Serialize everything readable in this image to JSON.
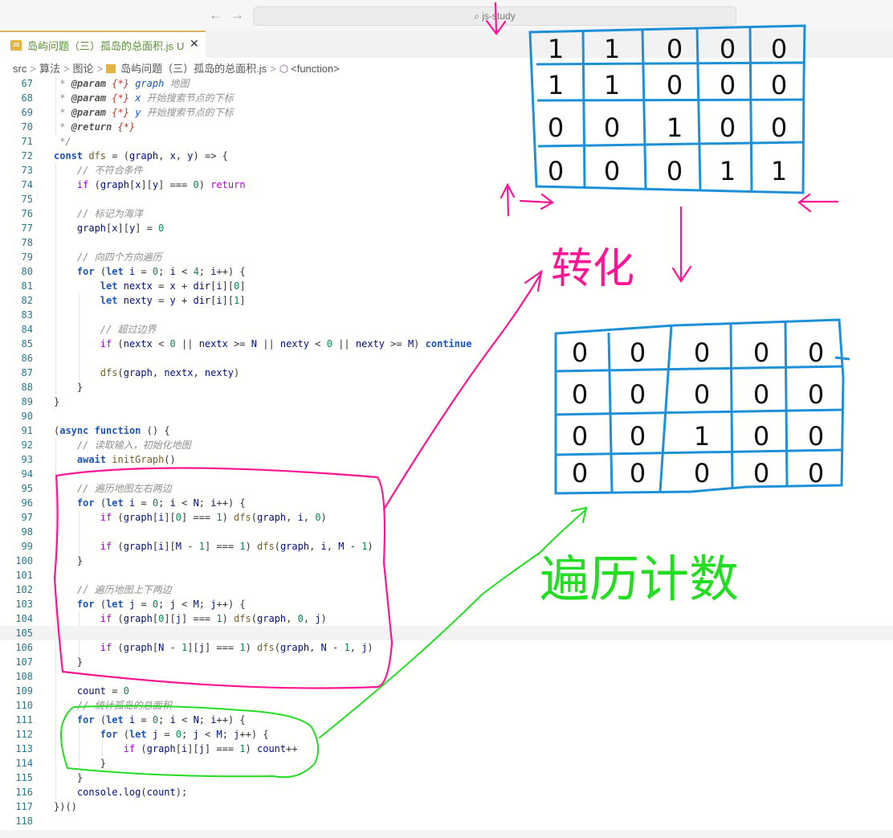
{
  "window": {
    "search_text": "js-study",
    "back_arrow": "←",
    "forward_arrow": "→"
  },
  "tab": {
    "badge": "JS",
    "title": "岛屿问题（三）孤岛的总面积.js",
    "status": "U",
    "close": "✕"
  },
  "breadcrumb": {
    "items": [
      "src",
      "算法",
      "图论",
      "岛屿问题（三）孤岛的总面积.js",
      "<function>"
    ],
    "separator": ">"
  },
  "colors": {
    "code_bg": "#fffffe",
    "line_number": "#237893",
    "keyword": "#0000ff",
    "comment": "#8e8e8e",
    "annotation_pink": "#ff1493",
    "annotation_green": "#22dd22",
    "grid_blue": "#1e90d8"
  },
  "code_lines": [
    {
      "num": "67",
      "text": " * @param {*} graph 地图"
    },
    {
      "num": "68",
      "text": " * @param {*} x 开始搜索节点的下标"
    },
    {
      "num": "69",
      "text": " * @param {*} y 开始搜索节点的下标"
    },
    {
      "num": "70",
      "text": " * @return {*}"
    },
    {
      "num": "71",
      "text": " */"
    },
    {
      "num": "72",
      "text": "const dfs = (graph, x, y) => {"
    },
    {
      "num": "73",
      "text": "    // 不符合条件"
    },
    {
      "num": "74",
      "text": "    if (graph[x][y] === 0) return"
    },
    {
      "num": "75",
      "text": ""
    },
    {
      "num": "76",
      "text": "    // 标记为海洋"
    },
    {
      "num": "77",
      "text": "    graph[x][y] = 0"
    },
    {
      "num": "78",
      "text": ""
    },
    {
      "num": "79",
      "text": "    // 向四个方向遍历"
    },
    {
      "num": "80",
      "text": "    for (let i = 0; i < 4; i++) {"
    },
    {
      "num": "81",
      "text": "        let nextx = x + dir[i][0]"
    },
    {
      "num": "82",
      "text": "        let nexty = y + dir[i][1]"
    },
    {
      "num": "83",
      "text": ""
    },
    {
      "num": "84",
      "text": "        // 超过边界"
    },
    {
      "num": "85",
      "text": "        if (nextx < 0 || nextx >= N || nexty < 0 || nexty >= M) continue"
    },
    {
      "num": "86",
      "text": ""
    },
    {
      "num": "87",
      "text": "        dfs(graph, nextx, nexty)"
    },
    {
      "num": "88",
      "text": "    }"
    },
    {
      "num": "89",
      "text": "}"
    },
    {
      "num": "90",
      "text": ""
    },
    {
      "num": "91",
      "text": "(async function () {"
    },
    {
      "num": "92",
      "text": "    // 读取输入，初始化地图"
    },
    {
      "num": "93",
      "text": "    await initGraph()"
    },
    {
      "num": "94",
      "text": ""
    },
    {
      "num": "95",
      "text": "    // 遍历地图左右两边"
    },
    {
      "num": "96",
      "text": "    for (let i = 0; i < N; i++) {"
    },
    {
      "num": "97",
      "text": "        if (graph[i][0] === 1) dfs(graph, i, 0)"
    },
    {
      "num": "98",
      "text": ""
    },
    {
      "num": "99",
      "text": "        if (graph[i][M - 1] === 1) dfs(graph, i, M - 1)"
    },
    {
      "num": "100",
      "text": "    }"
    },
    {
      "num": "101",
      "text": ""
    },
    {
      "num": "102",
      "text": "    // 遍历地图上下两边"
    },
    {
      "num": "103",
      "text": "    for (let j = 0; j < M; j++) {"
    },
    {
      "num": "104",
      "text": "        if (graph[0][j] === 1) dfs(graph, 0, j)"
    },
    {
      "num": "105",
      "text": ""
    },
    {
      "num": "106",
      "text": "        if (graph[N - 1][j] === 1) dfs(graph, N - 1, j)"
    },
    {
      "num": "107",
      "text": "    }"
    },
    {
      "num": "108",
      "text": ""
    },
    {
      "num": "109",
      "text": "    count = 0"
    },
    {
      "num": "110",
      "text": "    // 统计孤岛的总面积"
    },
    {
      "num": "111",
      "text": "    for (let i = 0; i < N; i++) {"
    },
    {
      "num": "112",
      "text": "        for (let j = 0; j < M; j++) {"
    },
    {
      "num": "113",
      "text": "            if (graph[i][j] === 1) count++"
    },
    {
      "num": "114",
      "text": "        }"
    },
    {
      "num": "115",
      "text": "    }"
    },
    {
      "num": "116",
      "text": "    console.log(count);"
    },
    {
      "num": "117",
      "text": "})()"
    },
    {
      "num": "118",
      "text": ""
    }
  ],
  "annotations": {
    "label_convert": "转化",
    "label_traverse_count": "遍历计数",
    "grid_before": [
      [
        "1",
        "1",
        "0",
        "0",
        "0"
      ],
      [
        "1",
        "1",
        "0",
        "0",
        "0"
      ],
      [
        "0",
        "0",
        "1",
        "0",
        "0"
      ],
      [
        "0",
        "0",
        "0",
        "1",
        "1"
      ]
    ],
    "grid_after": [
      [
        "0",
        "0",
        "0",
        "0",
        "0"
      ],
      [
        "0",
        "0",
        "0",
        "0",
        "0"
      ],
      [
        "0",
        "0",
        "1",
        "0",
        "0"
      ],
      [
        "0",
        "0",
        "0",
        "0",
        "0"
      ]
    ]
  }
}
